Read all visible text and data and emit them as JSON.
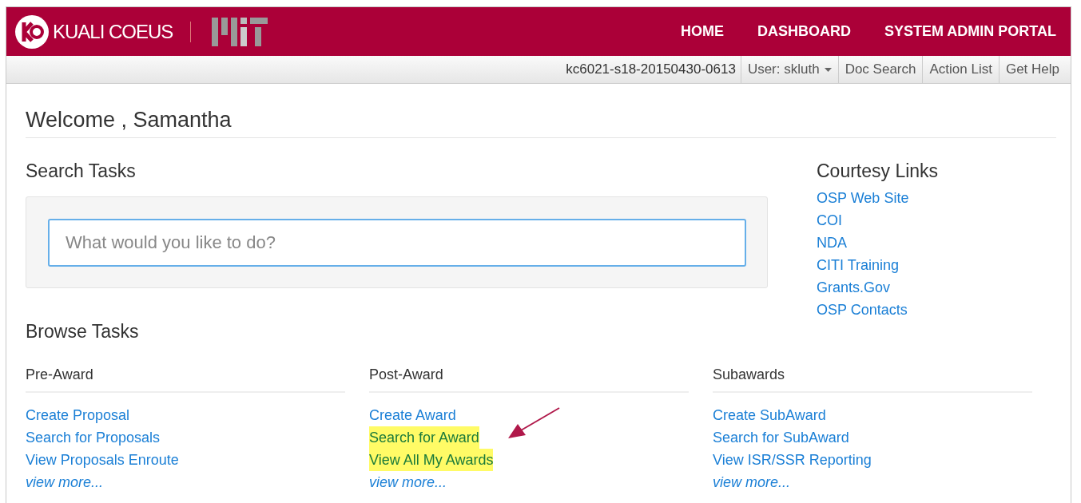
{
  "header": {
    "brand": "KUALI COEUS",
    "nav": [
      "HOME",
      "DASHBOARD",
      "SYSTEM ADMIN PORTAL"
    ]
  },
  "toolbar": {
    "build": "kc6021-s18-20150430-0613",
    "user_menu": "User: skluth",
    "buttons": [
      "Doc Search",
      "Action List",
      "Get Help"
    ]
  },
  "welcome": "Welcome , Samantha",
  "search_tasks": {
    "title": "Search Tasks",
    "placeholder": "What would you like to do?"
  },
  "courtesy_links": {
    "title": "Courtesy Links",
    "links": [
      "OSP Web Site",
      "COI",
      "NDA",
      "CITI Training",
      "Grants.Gov",
      "OSP Contacts"
    ]
  },
  "browse_tasks": {
    "title": "Browse Tasks",
    "columns": [
      {
        "title": "Pre-Award",
        "links": [
          {
            "label": "Create Proposal",
            "highlighted": false
          },
          {
            "label": "Search for Proposals",
            "highlighted": false
          },
          {
            "label": "View Proposals Enroute",
            "highlighted": false
          }
        ],
        "more": "view more..."
      },
      {
        "title": "Post-Award",
        "links": [
          {
            "label": "Create Award",
            "highlighted": false
          },
          {
            "label": "Search for Award",
            "highlighted": true
          },
          {
            "label": "View All My Awards",
            "highlighted": true
          }
        ],
        "more": "view more..."
      },
      {
        "title": "Subawards",
        "links": [
          {
            "label": "Create SubAward",
            "highlighted": false
          },
          {
            "label": "Search for SubAward",
            "highlighted": false
          },
          {
            "label": "View ISR/SSR Reporting",
            "highlighted": false
          }
        ],
        "more": "view more..."
      }
    ]
  }
}
